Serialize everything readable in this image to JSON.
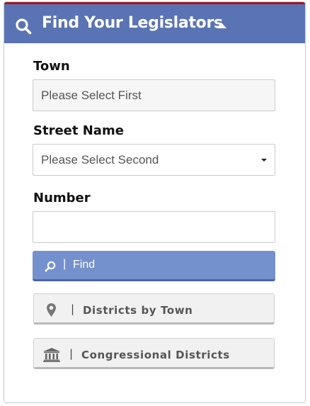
{
  "colors": {
    "header_bg": "#5a73b4",
    "header_accent": "#a1171b",
    "primary_button": "#7591cd",
    "secondary_button": "#f1f1f1"
  },
  "header": {
    "title": "Find Your Legislators",
    "icon": "search-icon",
    "toggle_icon": "caret-up-icon"
  },
  "form": {
    "town": {
      "label": "Town",
      "value": "Please Select First"
    },
    "street": {
      "label": "Street Name",
      "value": "Please Select Second"
    },
    "number": {
      "label": "Number",
      "value": ""
    }
  },
  "buttons": {
    "find": {
      "label": "Find",
      "icon": "search-icon",
      "separator": "|"
    },
    "districts_by_town": {
      "label": "Districts by Town",
      "icon": "map-marker-icon",
      "separator": "|"
    },
    "congressional_districts": {
      "label": "Congressional Districts",
      "icon": "institution-icon",
      "separator": "|"
    }
  }
}
